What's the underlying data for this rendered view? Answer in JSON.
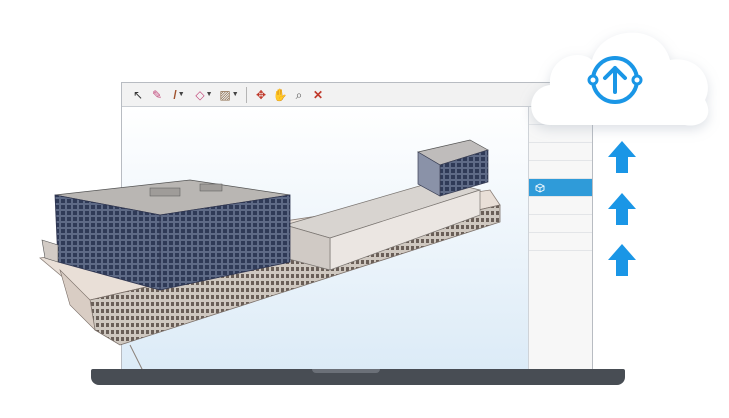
{
  "toolbar": {
    "tools": [
      {
        "name": "select-tool",
        "glyph": "↖"
      },
      {
        "name": "eraser-tool",
        "glyph": "✎"
      },
      {
        "name": "pencil-tool",
        "glyph": "/",
        "dropdown": true
      },
      {
        "name": "shape-tool",
        "glyph": "◇",
        "dropdown": true
      },
      {
        "name": "paint-tool",
        "glyph": "▨",
        "dropdown": true
      },
      {
        "name": "orbit-tool",
        "glyph": "✥"
      },
      {
        "name": "pan-tool",
        "glyph": "✋"
      },
      {
        "name": "zoom-tool",
        "glyph": "⌕"
      },
      {
        "name": "zoom-extents-tool",
        "glyph": "✕"
      }
    ]
  },
  "side_panel": {
    "selected_icon": "cube-icon"
  },
  "cloud": {
    "icon": "cloud-upload-icon",
    "accent": "#1a96e6"
  },
  "upload_arrows": {
    "count": 3,
    "color": "#1a96e6"
  },
  "colors": {
    "selection": "#2f9bd9",
    "laptop_base": "#484d54"
  }
}
